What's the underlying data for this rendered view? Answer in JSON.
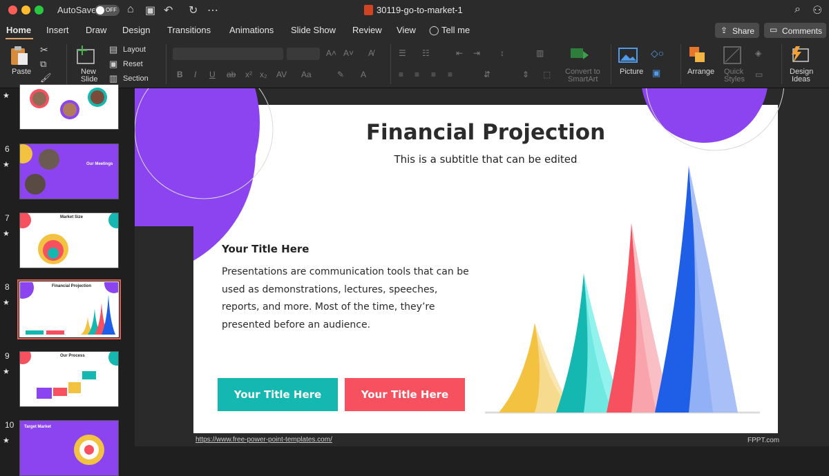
{
  "titlebar": {
    "autosave_label": "AutoSave",
    "autosave_state": "OFF",
    "document_title": "30119-go-to-market-1",
    "traffic_colors": [
      "#fe5f57",
      "#febc2e",
      "#28c840"
    ]
  },
  "menu": {
    "tabs": [
      "Home",
      "Insert",
      "Draw",
      "Design",
      "Transitions",
      "Animations",
      "Slide Show",
      "Review",
      "View"
    ],
    "tell_me": "Tell me",
    "share": "Share",
    "comments": "Comments"
  },
  "ribbon": {
    "paste": "Paste",
    "new_slide_1": "New",
    "new_slide_2": "Slide",
    "layout": "Layout",
    "reset": "Reset",
    "section": "Section",
    "convert_1": "Convert to",
    "convert_2": "SmartArt",
    "picture": "Picture",
    "arrange": "Arrange",
    "quick_styles_1": "Quick",
    "quick_styles_2": "Styles",
    "design_ideas_1": "Design",
    "design_ideas_2": "Ideas"
  },
  "thumbnails": [
    {
      "num": "",
      "title": ""
    },
    {
      "num": "6",
      "title": "Our Meetings"
    },
    {
      "num": "7",
      "title": "Market Size"
    },
    {
      "num": "8",
      "title": "Financial Projection",
      "selected": true
    },
    {
      "num": "9",
      "title": "Our Process"
    },
    {
      "num": "10",
      "title": "Target Market"
    }
  ],
  "slide": {
    "title": "Financial Projection",
    "subtitle": "This is a subtitle that can be edited",
    "body_title": "Your Title Here",
    "body_text": "Presentations are communication tools that can be used as demonstrations, lectures, speeches, reports, and more. Most of the time, they’re presented before an audience.",
    "button_left": "Your Title Here",
    "button_right": "Your Title Here",
    "colors": {
      "purple": "#8c44f0",
      "teal": "#14b8b0",
      "red": "#f7505e",
      "yellow": "#f2c240",
      "blue": "#1f5fe8"
    }
  },
  "footer": {
    "url": "https://www.free-power-point-templates.com/",
    "brand": "FPPT.com"
  }
}
